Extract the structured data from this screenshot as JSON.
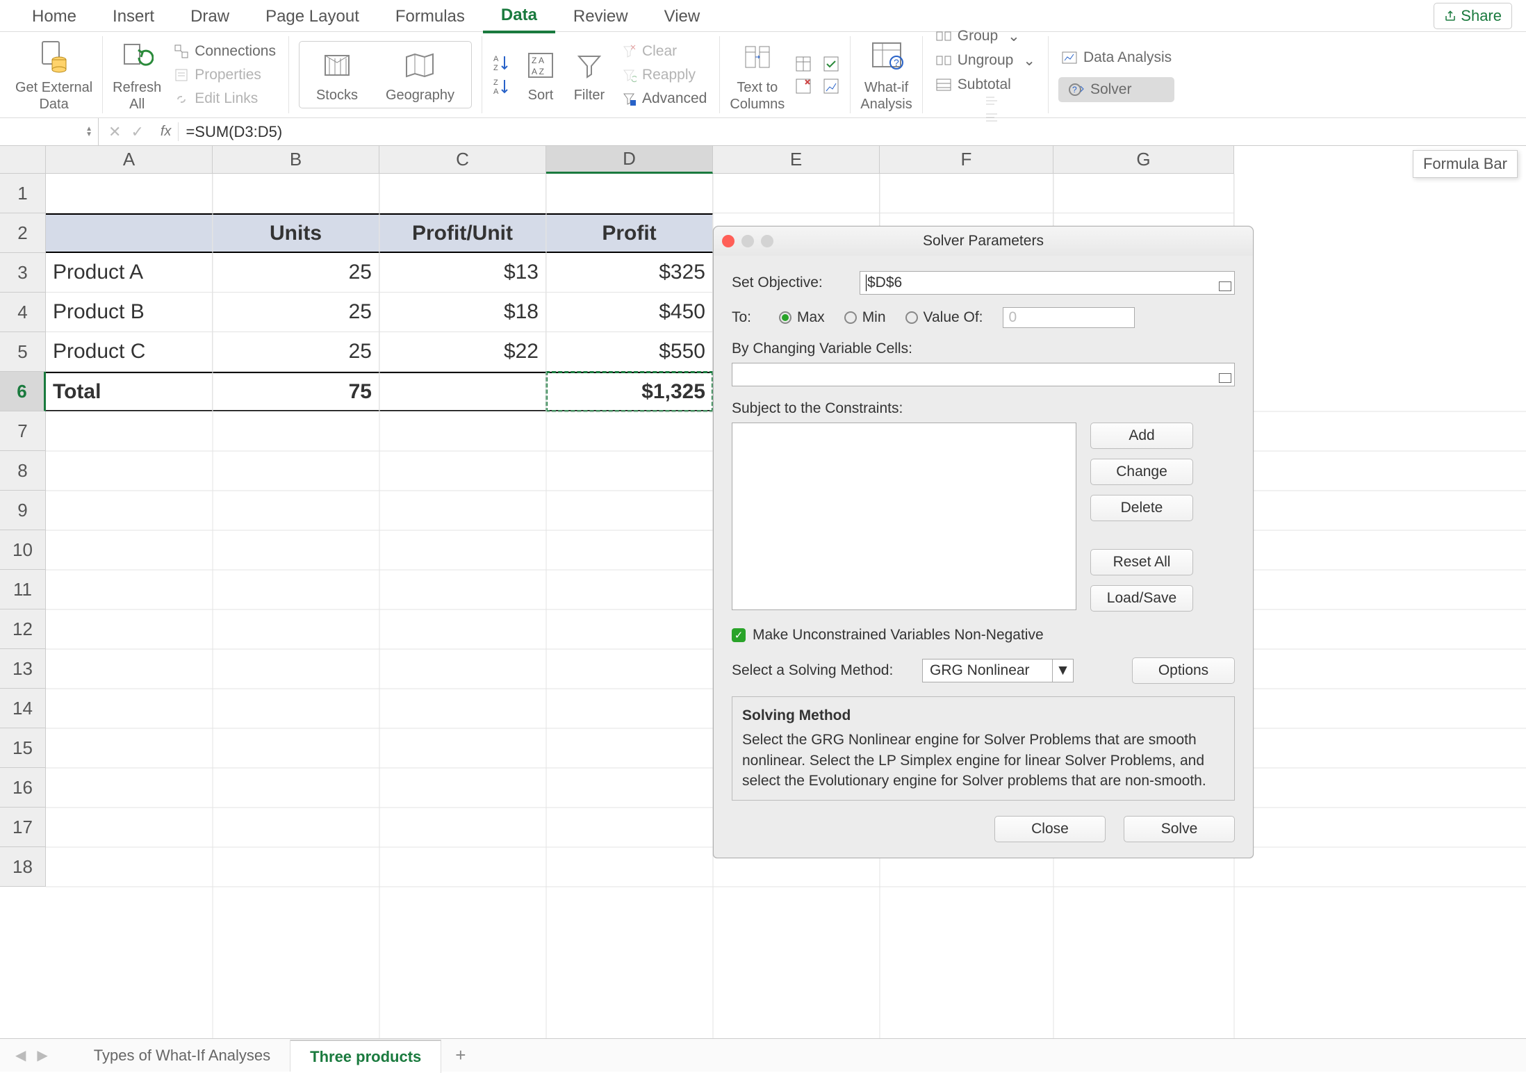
{
  "ribbon": {
    "tabs": [
      "Home",
      "Insert",
      "Draw",
      "Page Layout",
      "Formulas",
      "Data",
      "Review",
      "View"
    ],
    "active_tab": "Data",
    "share": "Share",
    "get_external_data": "Get External\nData",
    "refresh_all": "Refresh\nAll",
    "connections": "Connections",
    "properties": "Properties",
    "edit_links": "Edit Links",
    "stocks": "Stocks",
    "geography": "Geography",
    "sort": "Sort",
    "filter": "Filter",
    "clear": "Clear",
    "reapply": "Reapply",
    "advanced": "Advanced",
    "text_to_columns": "Text to\nColumns",
    "whatif": "What-if\nAnalysis",
    "group": "Group",
    "ungroup": "Ungroup",
    "subtotal": "Subtotal",
    "data_analysis": "Data Analysis",
    "solver": "Solver"
  },
  "formula_bar": {
    "fx": "fx",
    "formula": "=SUM(D3:D5)",
    "tooltip": "Formula Bar"
  },
  "columns": [
    "A",
    "B",
    "C",
    "D",
    "E",
    "F",
    "G"
  ],
  "rows_count": 18,
  "selected_cell": "D6",
  "table": {
    "h_units": "Units",
    "h_profit_unit": "Profit/Unit",
    "h_profit": "Profit",
    "r3_name": "Product A",
    "r3_units": "25",
    "r3_pu": "$13",
    "r3_p": "$325",
    "r4_name": "Product B",
    "r4_units": "25",
    "r4_pu": "$18",
    "r4_p": "$450",
    "r5_name": "Product C",
    "r5_units": "25",
    "r5_pu": "$22",
    "r5_p": "$550",
    "r6_name": "Total",
    "r6_units": "75",
    "r6_p": "$1,325"
  },
  "dialog": {
    "title": "Solver Parameters",
    "set_objective": "Set Objective:",
    "objective_value": "$D$6",
    "to": "To:",
    "max": "Max",
    "min": "Min",
    "value_of": "Value Of:",
    "value_of_input": "0",
    "changing_cells": "By Changing Variable Cells:",
    "constraints": "Subject to the Constraints:",
    "add": "Add",
    "change": "Change",
    "delete": "Delete",
    "reset_all": "Reset All",
    "load_save": "Load/Save",
    "unconstrained": "Make Unconstrained Variables Non-Negative",
    "select_method": "Select a Solving Method:",
    "method_value": "GRG Nonlinear",
    "options": "Options",
    "solving_method": "Solving Method",
    "solving_desc": "Select the GRG Nonlinear engine for Solver Problems that are smooth nonlinear. Select the LP Simplex engine for linear Solver Problems, and select the Evolutionary engine for Solver problems that are non-smooth.",
    "close": "Close",
    "solve": "Solve"
  },
  "sheet_tabs": {
    "tab1": "Types of What-If Analyses",
    "tab2": "Three products"
  }
}
